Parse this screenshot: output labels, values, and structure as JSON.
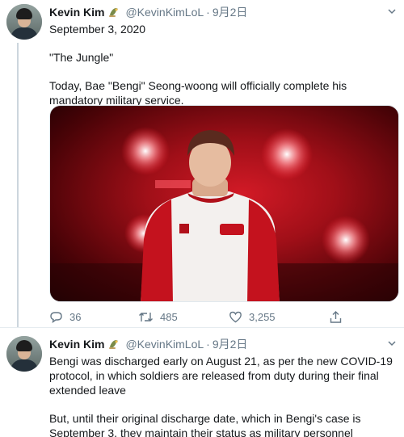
{
  "tweets": [
    {
      "author_name": "Kevin Kim",
      "handle": "@KevinKimLoL",
      "separator": "·",
      "time": "9月2日",
      "lines": [
        "September 3, 2020",
        "\"The Jungle\"",
        "Today, Bae \"Bengi\" Seong-woong will officially complete his mandatory military service."
      ],
      "stats": {
        "replies": "36",
        "retweets": "485",
        "likes": "3,255"
      }
    },
    {
      "author_name": "Kevin Kim",
      "handle": "@KevinKimLoL",
      "separator": "·",
      "time": "9月2日",
      "lines": [
        "Bengi was discharged early on August 21, as per the new COVID-19 protocol, in which soldiers are released from duty during their final extended leave",
        "But, until their original discharge date, which in Bengi's case is September 3, they maintain their status as military personnel"
      ]
    }
  ],
  "colors": {
    "text": "#14171a",
    "muted": "#657786",
    "divider": "#e6ecf0",
    "thread": "#ccd6dd"
  },
  "icons": [
    "reply-icon",
    "retweet-icon",
    "like-icon",
    "share-icon",
    "caret-down-icon",
    "emoji-icon"
  ]
}
